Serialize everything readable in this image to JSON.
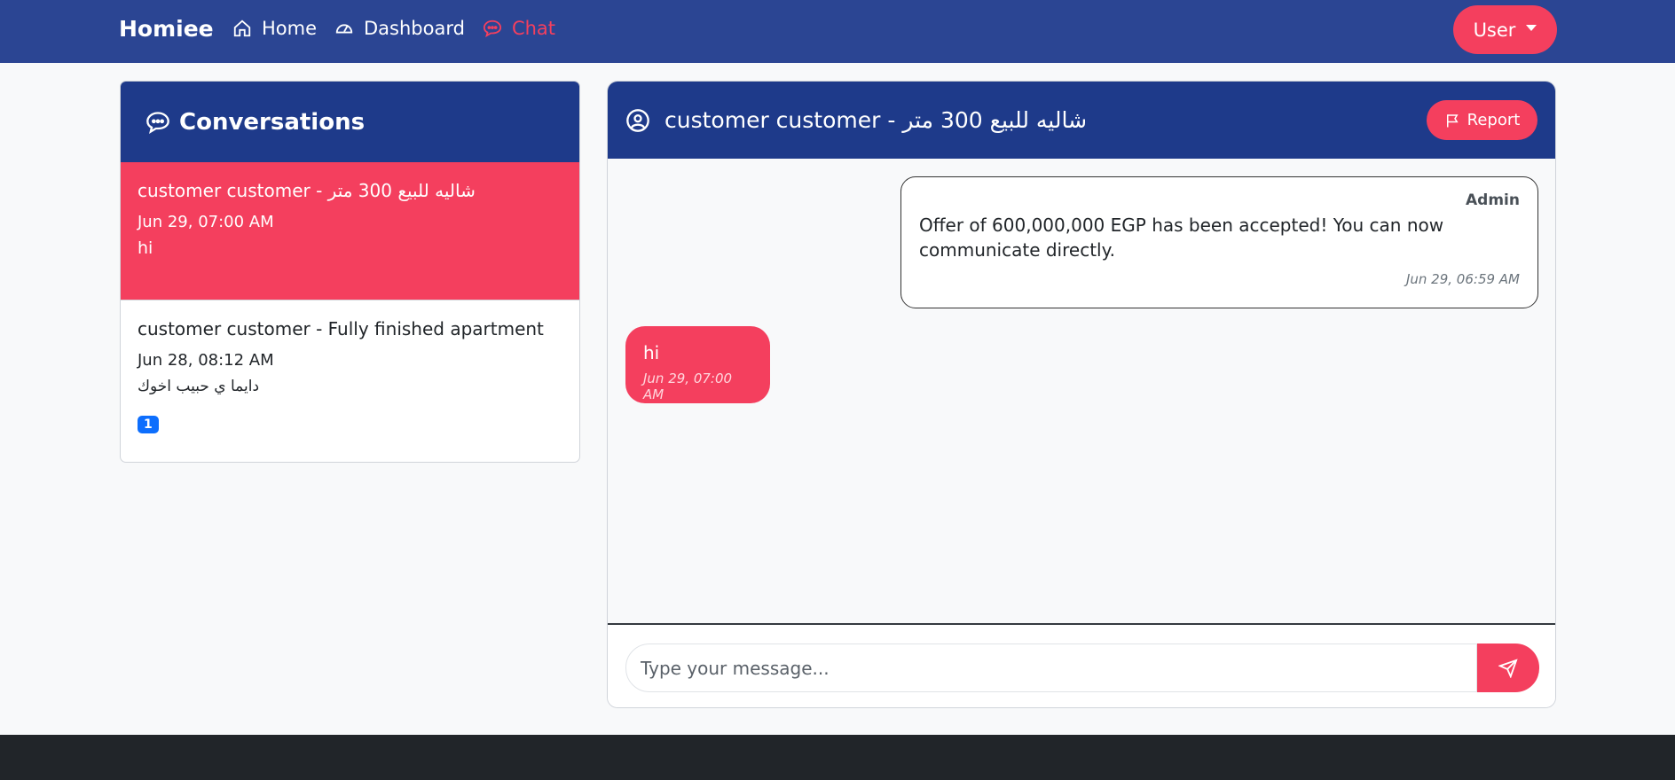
{
  "navbar": {
    "brand": "Homiee",
    "links": [
      {
        "label": "Home",
        "icon": "home-icon"
      },
      {
        "label": "Dashboard",
        "icon": "dashboard-icon"
      },
      {
        "label": "Chat",
        "icon": "chat-icon",
        "active": true
      }
    ],
    "user_menu": "User"
  },
  "conversations": {
    "title": "Conversations",
    "items": [
      {
        "name": "customer customer - شاليه للبيع 300 متر",
        "time": "Jun 29, 07:00 AM",
        "last_message": "hi",
        "active": true
      },
      {
        "name": "customer customer - Fully finished apartment",
        "time": "Jun 28, 08:12 AM",
        "last_message": "دايما ي حبيب اخوك",
        "unread": "1"
      }
    ]
  },
  "chat": {
    "title": "customer customer - شاليه للبيع 300 متر",
    "report_label": "Report",
    "messages": [
      {
        "sender": "Admin",
        "text": "Offer of 600,000,000 EGP has been accepted! You can now communicate directly.",
        "time": "Jun 29, 06:59 AM"
      },
      {
        "sender": "",
        "text": "hi",
        "time": "Jun 29, 07:00 AM"
      }
    ],
    "input_placeholder": "Type your message..."
  },
  "colors": {
    "navbar": "#2b4593",
    "header": "#1e3a8a",
    "accent": "#f43f5e",
    "badge": "#0d6efd",
    "footer": "#212529"
  }
}
